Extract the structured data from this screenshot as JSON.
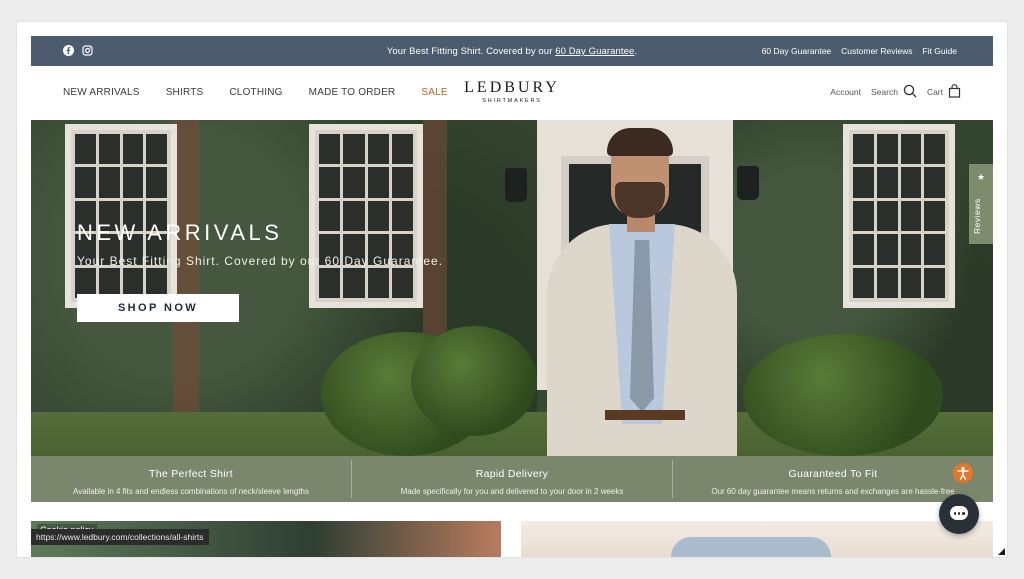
{
  "announcement": {
    "promo_prefix": "Your Best Fitting Shirt. Covered by our ",
    "promo_link": "60 Day Guarantee",
    "promo_suffix": ".",
    "links": [
      "60 Day Guarantee",
      "Customer Reviews",
      "Fit Guide"
    ],
    "social_icons": [
      "facebook-icon",
      "instagram-icon"
    ]
  },
  "nav": {
    "items": [
      "NEW ARRIVALS",
      "SHIRTS",
      "CLOTHING",
      "MADE TO ORDER",
      "SALE"
    ],
    "sale_color": "#b4642a"
  },
  "logo": {
    "main": "LEDBURY",
    "sub": "SHIRTMAKERS"
  },
  "utility": {
    "account": "Account",
    "search": "Search",
    "cart": "Cart"
  },
  "hero": {
    "title": "NEW ARRIVALS",
    "subtitle": "Your Best Fitting Shirt. Covered by our 60 Day Guarantee.",
    "cta": "SHOP NOW"
  },
  "reviews_tab": {
    "label": "Reviews",
    "icon": "star-icon"
  },
  "features": [
    {
      "title": "The Perfect Shirt",
      "desc": "Available in 4 fits and endless combinations of neck/sleeve lengths"
    },
    {
      "title": "Rapid Delivery",
      "desc": "Made specifically for you and delivered to your door in 2 weeks"
    },
    {
      "title": "Guaranteed To Fit",
      "desc": "Our 60 day guarantee means returns and exchanges are hassle-free"
    }
  ],
  "cookie_text": "Cookie policy",
  "status_url": "https://www.ledbury.com/collections/all-shirts",
  "colors": {
    "announce_bg": "#4d5b6e",
    "feature_bg": "#7b876c",
    "accessibility": "#e0772e",
    "chat": "#2a3038"
  }
}
